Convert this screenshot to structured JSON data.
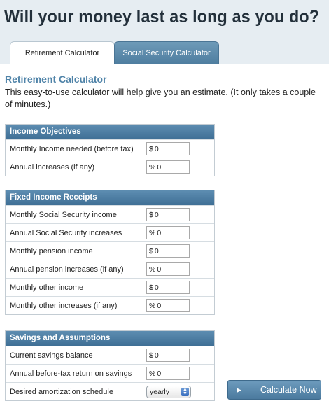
{
  "header": {
    "title": "Will your money last as long as you do?"
  },
  "tabs": [
    {
      "label": "Retirement Calculator",
      "active": true
    },
    {
      "label": "Social Security Calculator",
      "active": false
    }
  ],
  "section": {
    "title": "Retirement Calculator",
    "intro": "This easy-to-use calculator will help give you an estimate. (It only takes a couple of minutes.)"
  },
  "panels": {
    "income": {
      "title": "Income Objectives",
      "rows": [
        {
          "label": "Monthly Income needed (before tax)",
          "prefix": "$",
          "value": "0"
        },
        {
          "label": "Annual increases (if any)",
          "prefix": "%",
          "value": "0"
        }
      ]
    },
    "fixed": {
      "title": "Fixed Income Receipts",
      "rows": [
        {
          "label": "Monthly Social Security income",
          "prefix": "$",
          "value": "0"
        },
        {
          "label": "Annual Social Security increases",
          "prefix": "%",
          "value": "0"
        },
        {
          "label": "Monthly pension income",
          "prefix": "$",
          "value": "0"
        },
        {
          "label": "Annual pension increases (if any)",
          "prefix": "%",
          "value": "0"
        },
        {
          "label": "Monthly other income",
          "prefix": "$",
          "value": "0"
        },
        {
          "label": "Monthly other increases (if any)",
          "prefix": "%",
          "value": "0"
        }
      ]
    },
    "savings": {
      "title": "Savings and Assumptions",
      "rows": [
        {
          "label": "Current savings balance",
          "prefix": "$",
          "value": "0"
        },
        {
          "label": "Annual before-tax return on savings",
          "prefix": "%",
          "value": "0"
        },
        {
          "label": "Desired amortization schedule",
          "select": "yearly"
        }
      ]
    }
  },
  "actions": {
    "calculate_label": "Calculate Now"
  },
  "icons": {
    "calculate": "play-icon",
    "select": "select-arrows-icon"
  },
  "colors": {
    "accent": "#4f83a8",
    "panel_header": "#4a7ba0",
    "header_bg": "#e6edf2"
  }
}
